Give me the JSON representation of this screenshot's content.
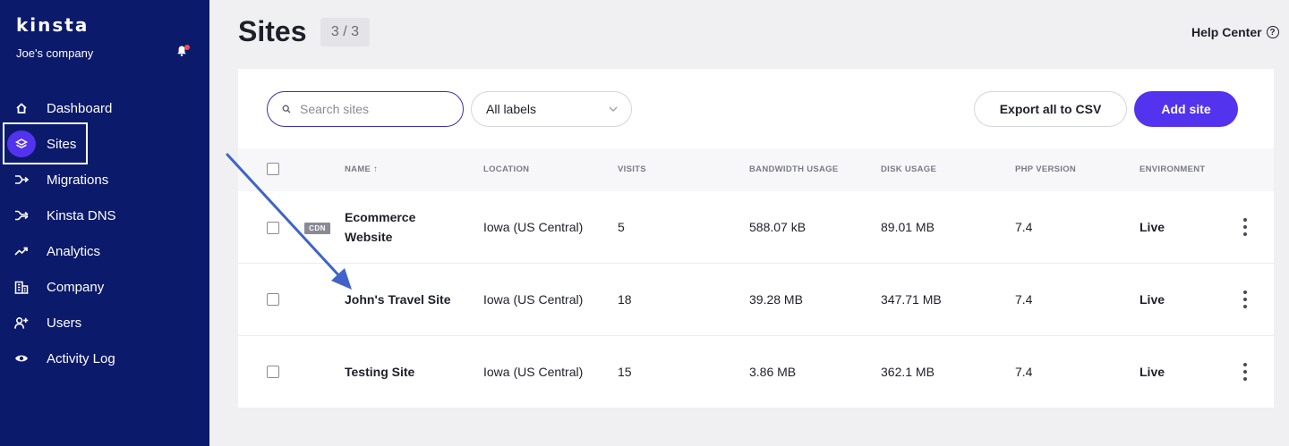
{
  "sidebar": {
    "logo": "kinsta",
    "company": "Joe's company",
    "items": [
      {
        "label": "Dashboard",
        "icon": "home-icon"
      },
      {
        "label": "Sites",
        "icon": "layers-icon",
        "active": true
      },
      {
        "label": "Migrations",
        "icon": "migrations-icon"
      },
      {
        "label": "Kinsta DNS",
        "icon": "dns-icon"
      },
      {
        "label": "Analytics",
        "icon": "analytics-icon"
      },
      {
        "label": "Company",
        "icon": "company-icon"
      },
      {
        "label": "Users",
        "icon": "add-user-icon"
      },
      {
        "label": "Activity Log",
        "icon": "eye-icon"
      }
    ]
  },
  "header": {
    "title": "Sites",
    "count": "3 / 3",
    "help": "Help Center"
  },
  "toolbar": {
    "search_placeholder": "Search sites",
    "labels_select": "All labels",
    "export_label": "Export all to CSV",
    "add_label": "Add site"
  },
  "table": {
    "columns": [
      "NAME",
      "LOCATION",
      "VISITS",
      "BANDWIDTH USAGE",
      "DISK USAGE",
      "PHP VERSION",
      "ENVIRONMENT"
    ],
    "sort_indicator": "↑",
    "rows": [
      {
        "name": "Ecommerce Website",
        "cdn": "CDN",
        "location": "Iowa (US Central)",
        "visits": "5",
        "bandwidth": "588.07 kB",
        "disk": "89.01 MB",
        "php": "7.4",
        "environment": "Live"
      },
      {
        "name": "John's Travel Site",
        "cdn": "",
        "location": "Iowa (US Central)",
        "visits": "18",
        "bandwidth": "39.28 MB",
        "disk": "347.71 MB",
        "php": "7.4",
        "environment": "Live"
      },
      {
        "name": "Testing Site",
        "cdn": "",
        "location": "Iowa (US Central)",
        "visits": "15",
        "bandwidth": "3.86 MB",
        "disk": "362.1 MB",
        "php": "7.4",
        "environment": "Live"
      }
    ]
  },
  "colors": {
    "sidebar_bg": "#0c1a6b",
    "accent": "#5333ed",
    "annotation_arrow": "#3f63c9"
  }
}
